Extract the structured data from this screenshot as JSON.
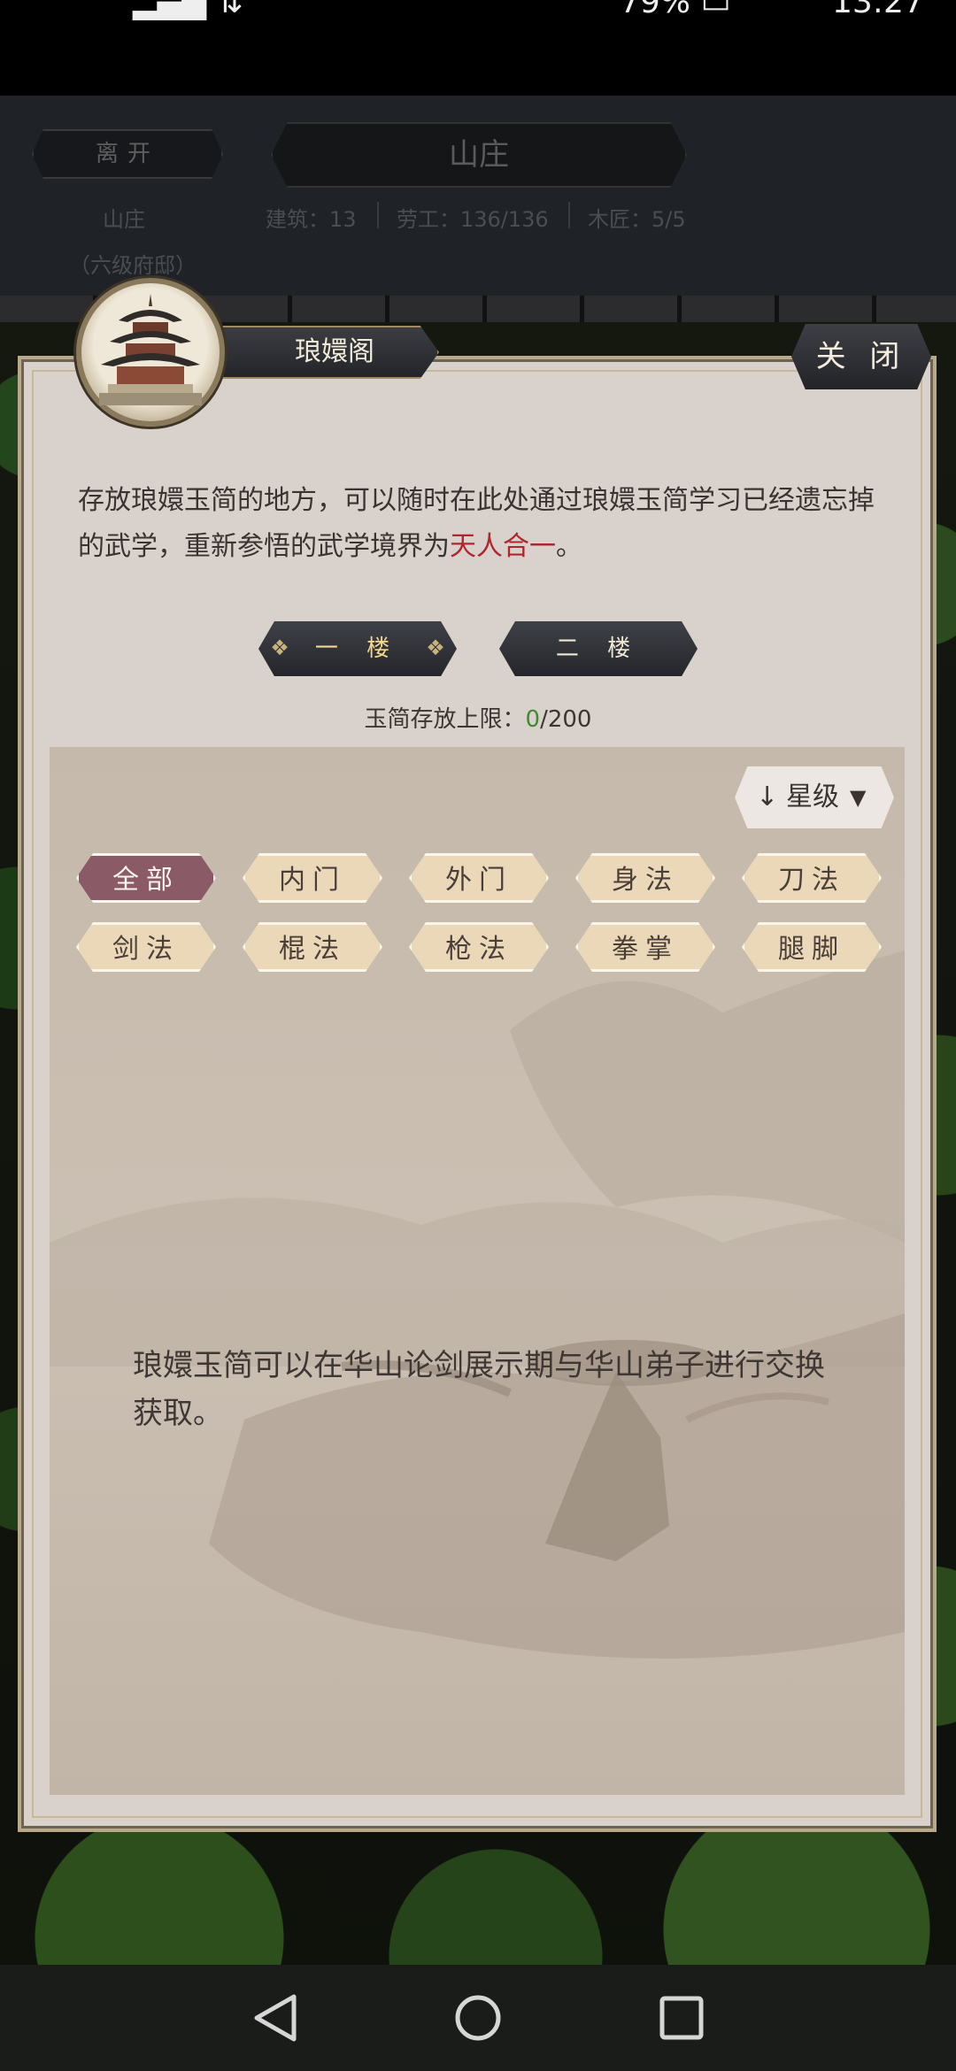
{
  "status_bar": {
    "battery": "79%",
    "time": "13:27"
  },
  "background_ui": {
    "leave_label": "离开",
    "title": "山庄",
    "estate_name": "山庄",
    "estate_level": "（六级府邸）",
    "stats": [
      {
        "label": "建筑：13"
      },
      {
        "label": "劳工：136/136"
      },
      {
        "label": "木匠：5/5"
      }
    ]
  },
  "panel": {
    "title": "琅嬛阁",
    "close_label": "关 闭",
    "description_prefix": "存放琅嬛玉简的地方，可以随时在此处通过琅嬛玉简学习已经遗忘掉的武学，重新参悟的武学境界为",
    "description_highlight": "天人合一",
    "description_suffix": "。",
    "floors": [
      {
        "label": "一 楼",
        "active": true
      },
      {
        "label": "二 楼",
        "active": false
      }
    ],
    "capacity_label": "玉简存放上限：",
    "capacity_current": "0",
    "capacity_max": "/200",
    "sort_label": "星级",
    "filters": [
      {
        "label": "全部",
        "active": true
      },
      {
        "label": "内门"
      },
      {
        "label": "外门"
      },
      {
        "label": "身法"
      },
      {
        "label": "刀法"
      },
      {
        "label": "剑法"
      },
      {
        "label": "棍法"
      },
      {
        "label": "枪法"
      },
      {
        "label": "拳掌"
      },
      {
        "label": "腿脚"
      }
    ],
    "empty_message": "琅嬛玉简可以在华山论剑展示期与华山弟子进行交换获取。"
  },
  "colors": {
    "panel_bg": "#d9d1cc",
    "highlight_red": "#b0262c",
    "count_green": "#3f8c2d",
    "active_chip": "#8a5a66",
    "chip_bg": "#ead8b8"
  }
}
